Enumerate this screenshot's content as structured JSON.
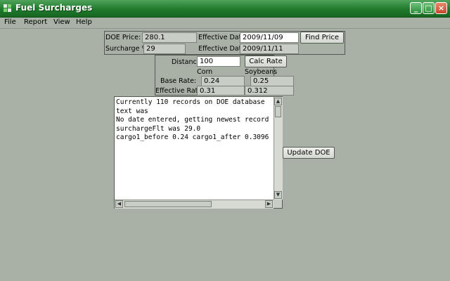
{
  "window": {
    "title": "Fuel Surcharges"
  },
  "menu": [
    "File",
    "Report",
    "View",
    "Help"
  ],
  "doe": {
    "price_label": "DOE Price:",
    "price_value": "280.1",
    "surcharge_label": "Surcharge %:",
    "surcharge_value": "29",
    "eff_date_label_1": "Effective Date:",
    "eff_date_value_1": "2009/11/09",
    "eff_date_label_2": "Effective Date:",
    "eff_date_value_2": "2009/11/11",
    "find_price_button": "Find Price"
  },
  "rate": {
    "distance_label": "Distance:",
    "distance_value": "100",
    "calc_rate_button": "Calc Rate",
    "col_corn": "Corn",
    "col_soybeans": "Soybeans",
    "base_rate_label": "Base Rate:",
    "base_corn": "0.24",
    "base_soy": "0.25",
    "eff_rate_label": "Effective Rate:",
    "eff_corn": "0.31",
    "eff_soy": "0.312"
  },
  "log": {
    "text": "Currently 110 records on DOE database\ntext was\nNo date entered, getting newest record\nsurchargeFlt was 29.0\ncargo1_before 0.24 cargo1_after 0.3096"
  },
  "update_doe_button": "Update DOE",
  "colors": {
    "titlebar": "#1f7a2d",
    "background": "#a9b0a5"
  },
  "icons": [
    "app-icon",
    "minimize-icon",
    "maximize-icon",
    "close-icon",
    "scroll-up-arrow-icon",
    "scroll-down-arrow-icon",
    "scroll-left-arrow-icon",
    "scroll-right-arrow-icon"
  ]
}
